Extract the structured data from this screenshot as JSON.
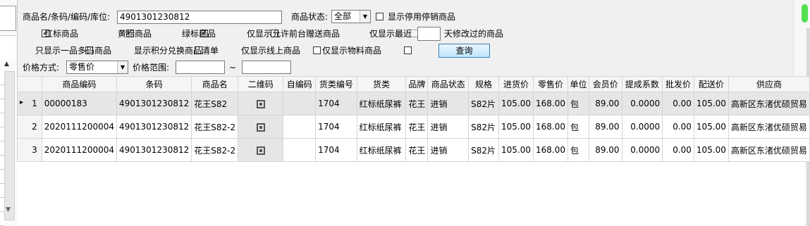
{
  "filters": {
    "search_label": "商品名/条码/编码/库位:",
    "search_value": "4901301230812",
    "status_label": "商品状态:",
    "status_value": "全部",
    "show_disabled_label": "显示停用停销商品",
    "red_label": "红标商品",
    "yellow_label": "黄标商品",
    "green_label": "绿标商品",
    "front_gift_label": "仅显示允许前台赠送商品",
    "recent_label": "仅显示最近",
    "recent_days_value": "",
    "recent_suffix": "天修改过的商品",
    "multi_code_label": "只显示一品多码商品",
    "points_label": "显示积分兑换商品清单",
    "online_label": "仅显示线上商品",
    "material_label": "仅显示物料商品",
    "query_label": "查询",
    "price_mode_label": "价格方式:",
    "price_mode_value": "零售价",
    "price_range_label": "价格范围:",
    "price_min": "",
    "tilde": "~",
    "price_max": ""
  },
  "table": {
    "columns": [
      "商品编码",
      "条码",
      "商品名",
      "二维码",
      "自编码",
      "货类编号",
      "货类",
      "品牌",
      "商品状态",
      "规格",
      "进货价",
      "零售价",
      "单位",
      "会员价",
      "提成系数",
      "批发价",
      "配送价",
      "供应商"
    ],
    "rows": [
      {
        "row_no": "1",
        "cells": [
          "00000183",
          "4901301230812",
          "花王S82",
          "",
          "",
          "1704",
          "红标纸尿裤",
          "花王",
          "进销",
          "S82片",
          "105.00",
          "168.00",
          "包",
          "89.00",
          "0.0000",
          "0.00",
          "105.00",
          "高新区东渚优硕贸易"
        ]
      },
      {
        "row_no": "2",
        "cells": [
          "2020111200004",
          "4901301230812",
          "花王S82-2",
          "",
          "",
          "1704",
          "红标纸尿裤",
          "花王",
          "进销",
          "S82片",
          "105.00",
          "168.00",
          "包",
          "89.00",
          "0.0000",
          "0.00",
          "105.00",
          "高新区东渚优硕贸易"
        ]
      },
      {
        "row_no": "3",
        "cells": [
          "2020111200004",
          "4901301230812",
          "花王S82-2",
          "",
          "",
          "1704",
          "红标纸尿裤",
          "花王",
          "进销",
          "S82片",
          "105.00",
          "168.00",
          "包",
          "89.00",
          "0.0000",
          "0.00",
          "105.00",
          "高新区东渚优硕贸易"
        ]
      }
    ]
  },
  "icons": {
    "current_row": "row-pointer-icon",
    "qr": "qr-code-icon",
    "dropdown": "chevron-down-icon"
  }
}
